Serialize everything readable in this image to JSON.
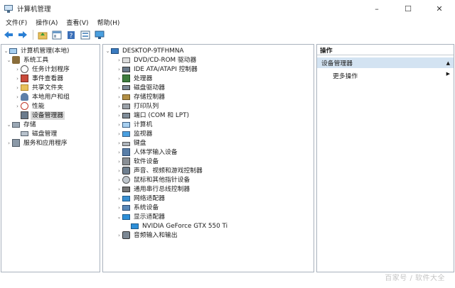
{
  "window": {
    "title": "计算机管理",
    "minimize": "–",
    "maximize": "☐",
    "close": "✕"
  },
  "menu": [
    "文件(F)",
    "操作(A)",
    "查看(V)",
    "帮助(H)"
  ],
  "toolbar": [
    "back-arrow-icon",
    "forward-arrow-icon",
    "up-folder-icon",
    "show-hide-tree-icon",
    "help-icon",
    "properties-icon",
    "display-icon"
  ],
  "left_tree": {
    "root": "计算机管理(本地)",
    "system_tools": "系统工具",
    "task_scheduler": "任务计划程序",
    "event_viewer": "事件查看器",
    "shared_folders": "共享文件夹",
    "local_users": "本地用户和组",
    "performance": "性能",
    "device_manager": "设备管理器",
    "storage": "存储",
    "disk_management": "磁盘管理",
    "services_apps": "服务和应用程序"
  },
  "device_tree": {
    "root": "DESKTOP-9TFHMNA",
    "categories": [
      {
        "label": "DVD/CD-ROM 驱动器",
        "icon": "dvd-drive-icon"
      },
      {
        "label": "IDE ATA/ATAPI 控制器",
        "icon": "ide-controller-icon"
      },
      {
        "label": "处理器",
        "icon": "processor-icon"
      },
      {
        "label": "磁盘驱动器",
        "icon": "disk-drive-icon"
      },
      {
        "label": "存储控制器",
        "icon": "storage-controller-icon"
      },
      {
        "label": "打印队列",
        "icon": "printer-icon"
      },
      {
        "label": "端口 (COM 和 LPT)",
        "icon": "port-icon"
      },
      {
        "label": "计算机",
        "icon": "computer-icon"
      },
      {
        "label": "监视器",
        "icon": "monitor-icon"
      },
      {
        "label": "键盘",
        "icon": "keyboard-icon"
      },
      {
        "label": "人体学输入设备",
        "icon": "hid-icon"
      },
      {
        "label": "软件设备",
        "icon": "software-device-icon"
      },
      {
        "label": "声音、视频和游戏控制器",
        "icon": "sound-icon"
      },
      {
        "label": "鼠标和其他指针设备",
        "icon": "mouse-icon"
      },
      {
        "label": "通用串行总线控制器",
        "icon": "usb-icon"
      },
      {
        "label": "网络适配器",
        "icon": "network-adapter-icon"
      },
      {
        "label": "系统设备",
        "icon": "system-device-icon"
      },
      {
        "label": "显示适配器",
        "icon": "display-adapter-icon",
        "expanded": true
      },
      {
        "label": "NVIDIA GeForce GTX 550 Ti",
        "icon": "gpu-icon",
        "child": true
      },
      {
        "label": "音频输入和输出",
        "icon": "audio-io-icon"
      }
    ]
  },
  "actions": {
    "header": "操作",
    "section": "设备管理器",
    "more": "更多操作"
  },
  "watermark": "百家号 / 软件大全"
}
